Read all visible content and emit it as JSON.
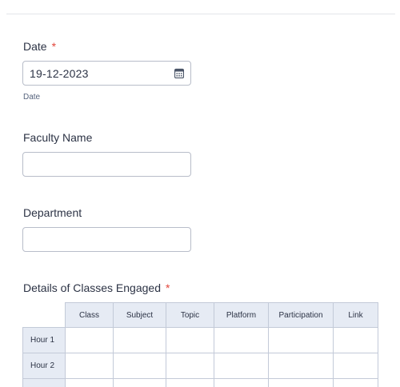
{
  "form": {
    "date": {
      "label": "Date",
      "required_mark": "*",
      "value": "19-12-2023",
      "sublabel": "Date",
      "icon": "calendar-icon"
    },
    "faculty_name": {
      "label": "Faculty Name",
      "value": ""
    },
    "department": {
      "label": "Department",
      "value": ""
    },
    "classes": {
      "label": "Details of Classes Engaged",
      "required_mark": "*",
      "columns": [
        "Class",
        "Subject",
        "Topic",
        "Platform",
        "Participation",
        "Link"
      ],
      "rows": [
        "Hour 1",
        "Hour 2",
        ""
      ]
    }
  },
  "colors": {
    "required": "#e2463b",
    "header_bg": "#e6ebf4",
    "border": "#b8bdc9",
    "text": "#2c3345"
  }
}
